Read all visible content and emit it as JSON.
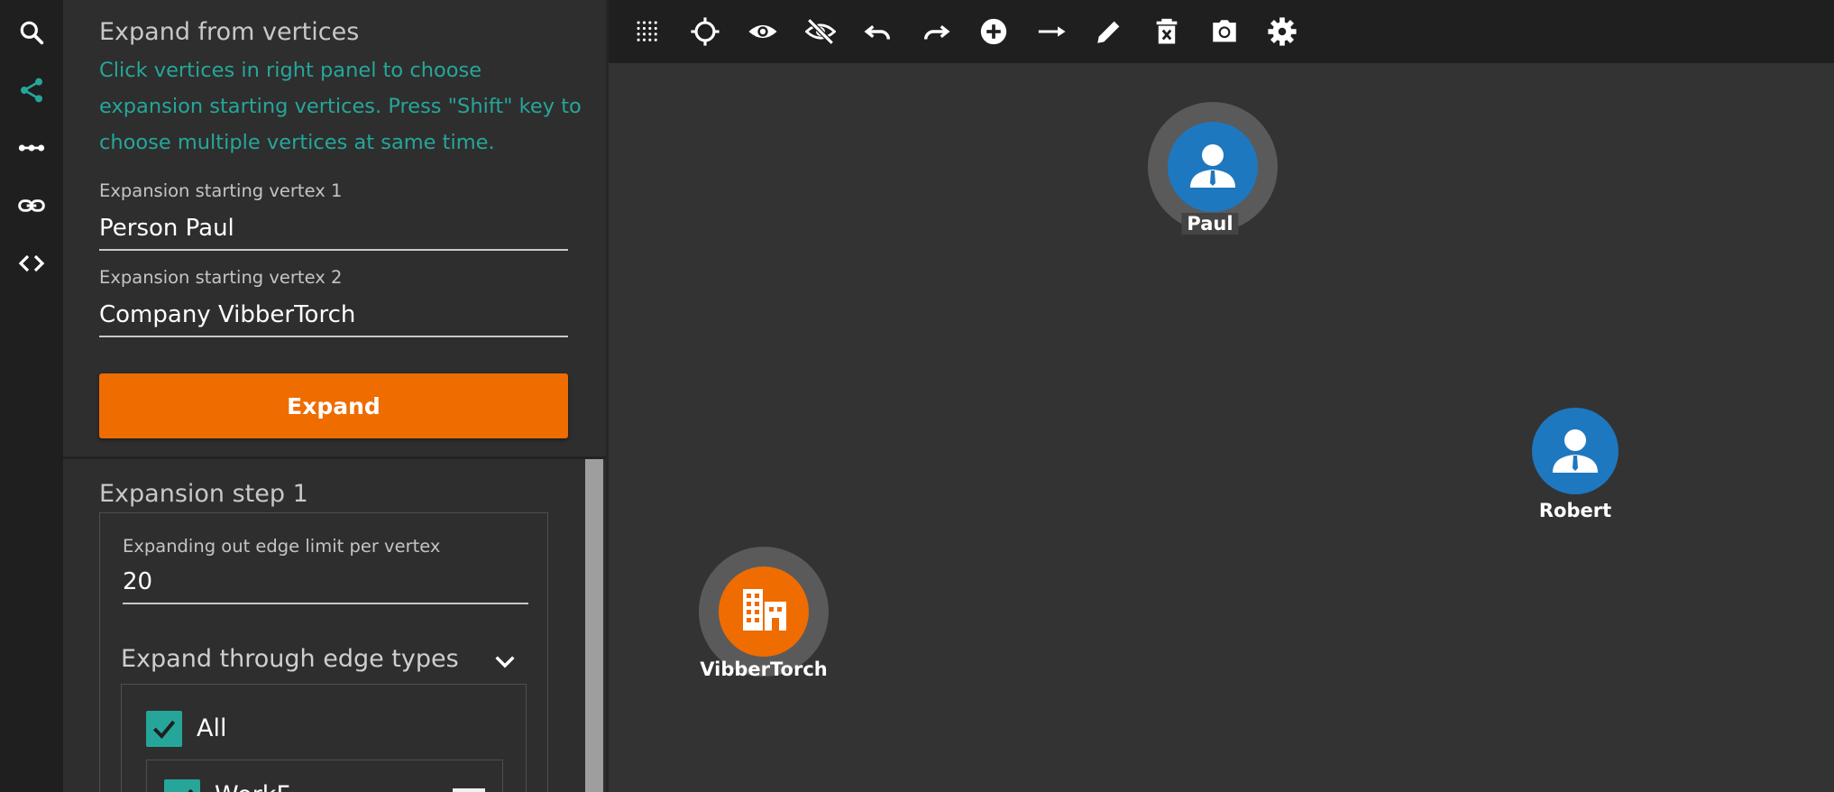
{
  "panel": {
    "section_title": "Expand from vertices",
    "hint": "Click vertices in right panel to choose expansion starting vertices. Press \"Shift\" key to choose multiple vertices at same time.",
    "vertex1_label": "Expansion starting vertex 1",
    "vertex1_value": "Person Paul",
    "vertex2_label": "Expansion starting vertex 2",
    "vertex2_value": "Company VibberTorch",
    "expand_label": "Expand",
    "step_title": "Expansion step 1",
    "edge_limit_label": "Expanding out edge limit per vertex",
    "edge_limit_value": "20",
    "edge_types_title": "Expand through edge types",
    "all_label": "All",
    "partial_label": "WorkF"
  },
  "rail": {
    "icons": [
      "search-icon",
      "share-icon",
      "path-icon",
      "link-icon",
      "code-icon"
    ],
    "active": "share-icon"
  },
  "toolbar": {
    "icons": [
      "grid-icon",
      "crosshair-icon",
      "eye-icon",
      "eye-off-icon",
      "undo-icon",
      "redo-icon",
      "add-circle-icon",
      "arrow-right-icon",
      "pencil-icon",
      "delete-icon",
      "camera-icon",
      "gear-icon"
    ]
  },
  "graph": {
    "nodes": [
      {
        "label": "Paul",
        "type": "person",
        "color": "#1e78c0",
        "selected": true
      },
      {
        "label": "Robert",
        "type": "person",
        "color": "#1e78c0",
        "selected": false
      },
      {
        "label": "VibberTorch",
        "type": "company",
        "color": "#ef6c00",
        "selected": true
      }
    ]
  },
  "colors": {
    "accent": "#26a69a",
    "primary_button": "#ef6c00",
    "person_node": "#1e78c0",
    "company_node": "#ef6c00"
  }
}
